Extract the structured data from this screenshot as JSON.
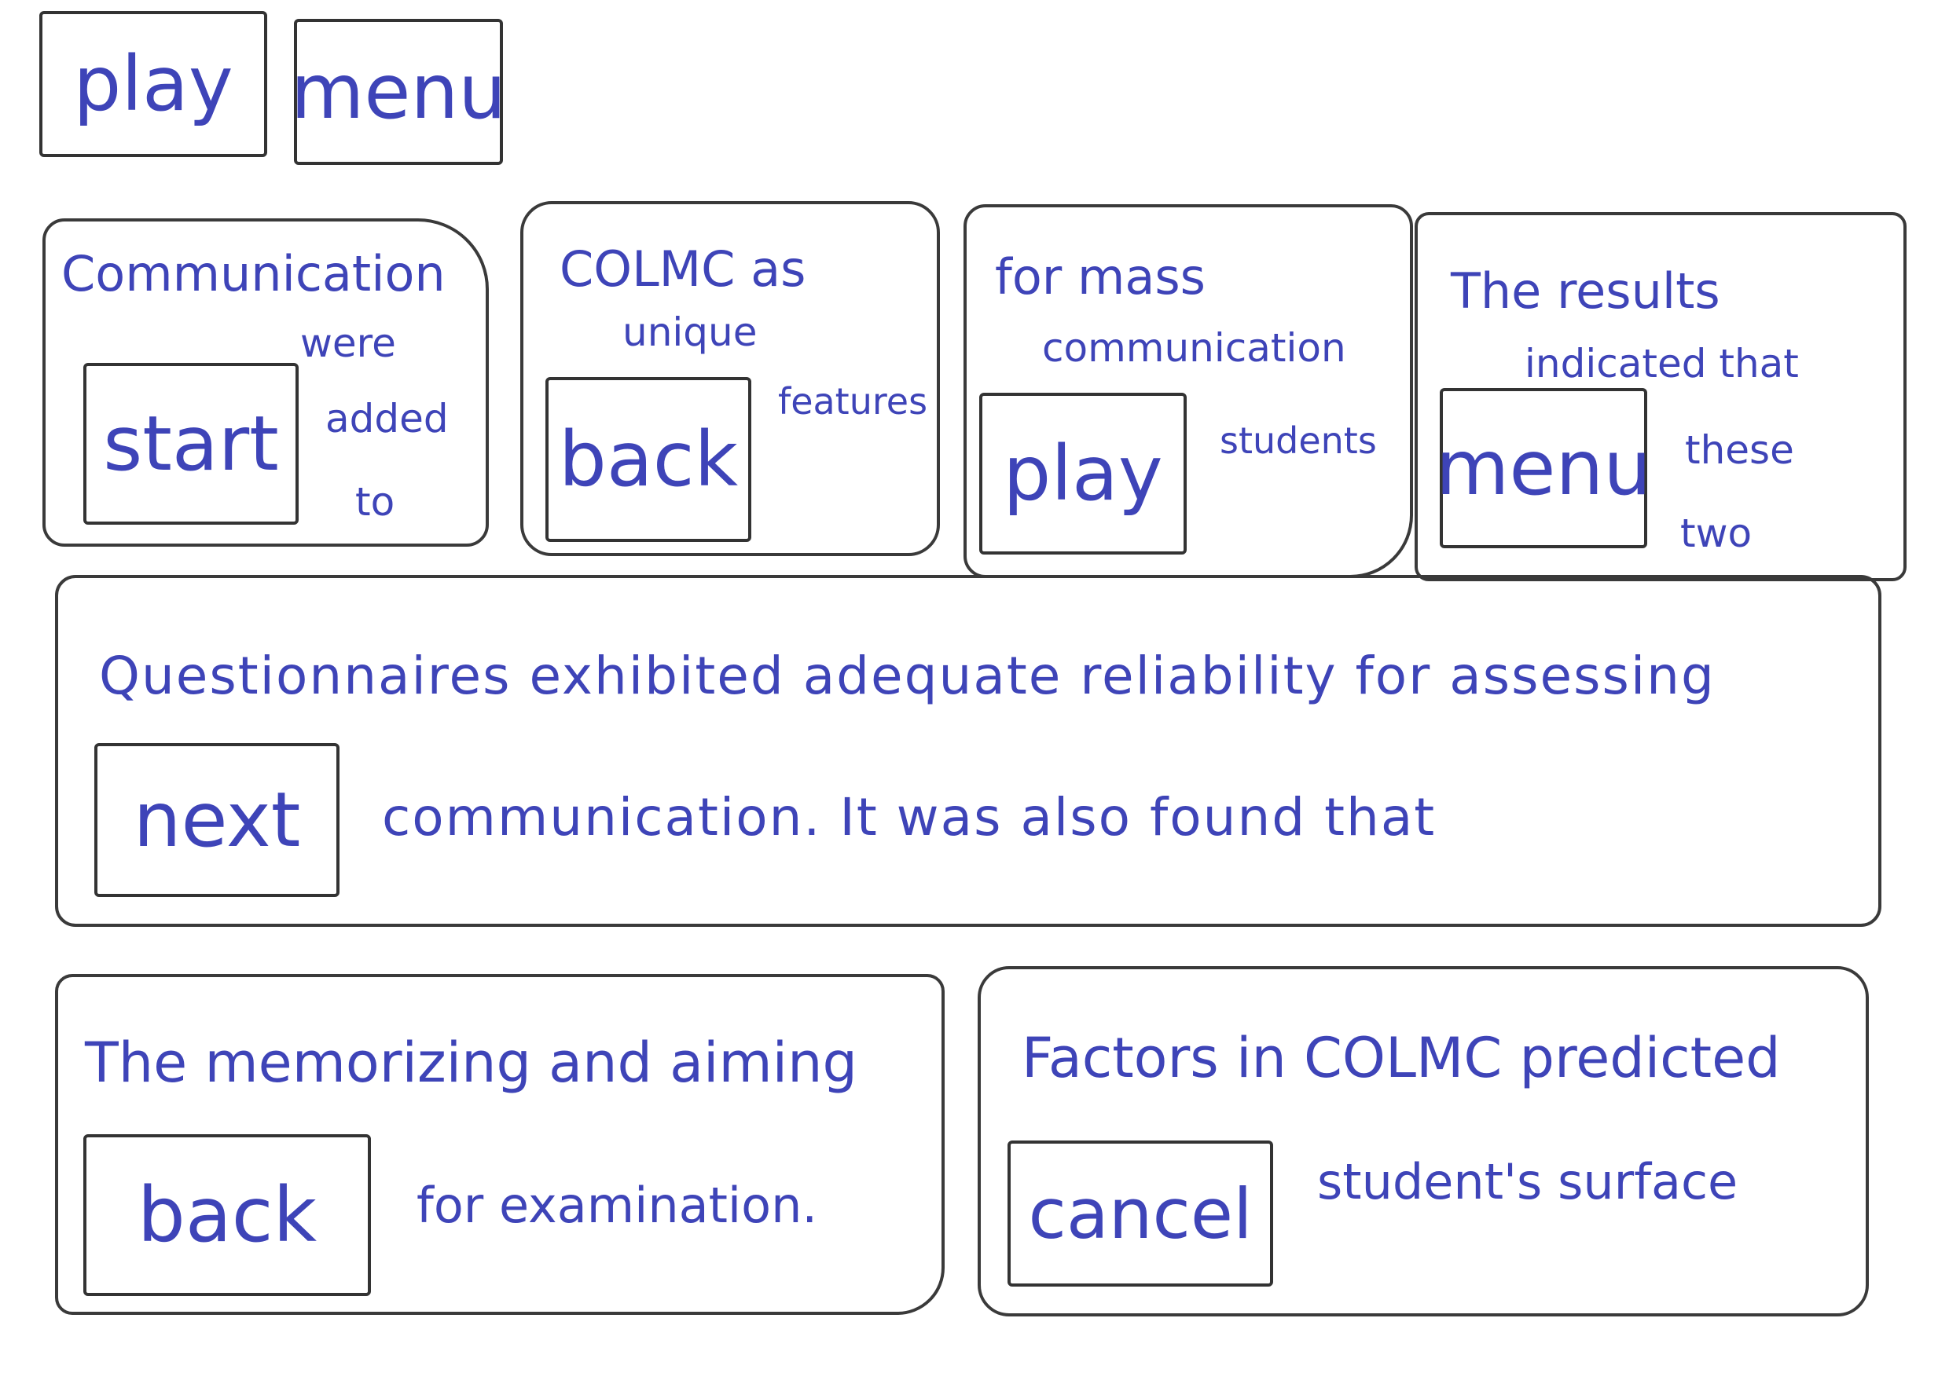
{
  "toolbar": {
    "play_label": "play",
    "menu_label": "menu"
  },
  "cards": [
    {
      "lines": [
        "Communication",
        "were",
        "added",
        "to"
      ],
      "button": "start"
    },
    {
      "lines": [
        "COLMC as",
        "unique",
        "features"
      ],
      "button": "back"
    },
    {
      "lines": [
        "for mass",
        "communication",
        "students"
      ],
      "button": "play"
    },
    {
      "lines": [
        "The results",
        "indicated that",
        "these",
        "two"
      ],
      "button": "menu"
    }
  ],
  "wide_panel": {
    "line1": "Questionnaires exhibited adequate reliability for assessing",
    "line2": "communication. It was also found that",
    "button": "next"
  },
  "bottom_left": {
    "line1": "The memorizing and aiming",
    "line2": "for examination.",
    "button": "back"
  },
  "bottom_right": {
    "line1": "Factors in COLMC predicted",
    "line2": "student's surface",
    "button": "cancel"
  }
}
